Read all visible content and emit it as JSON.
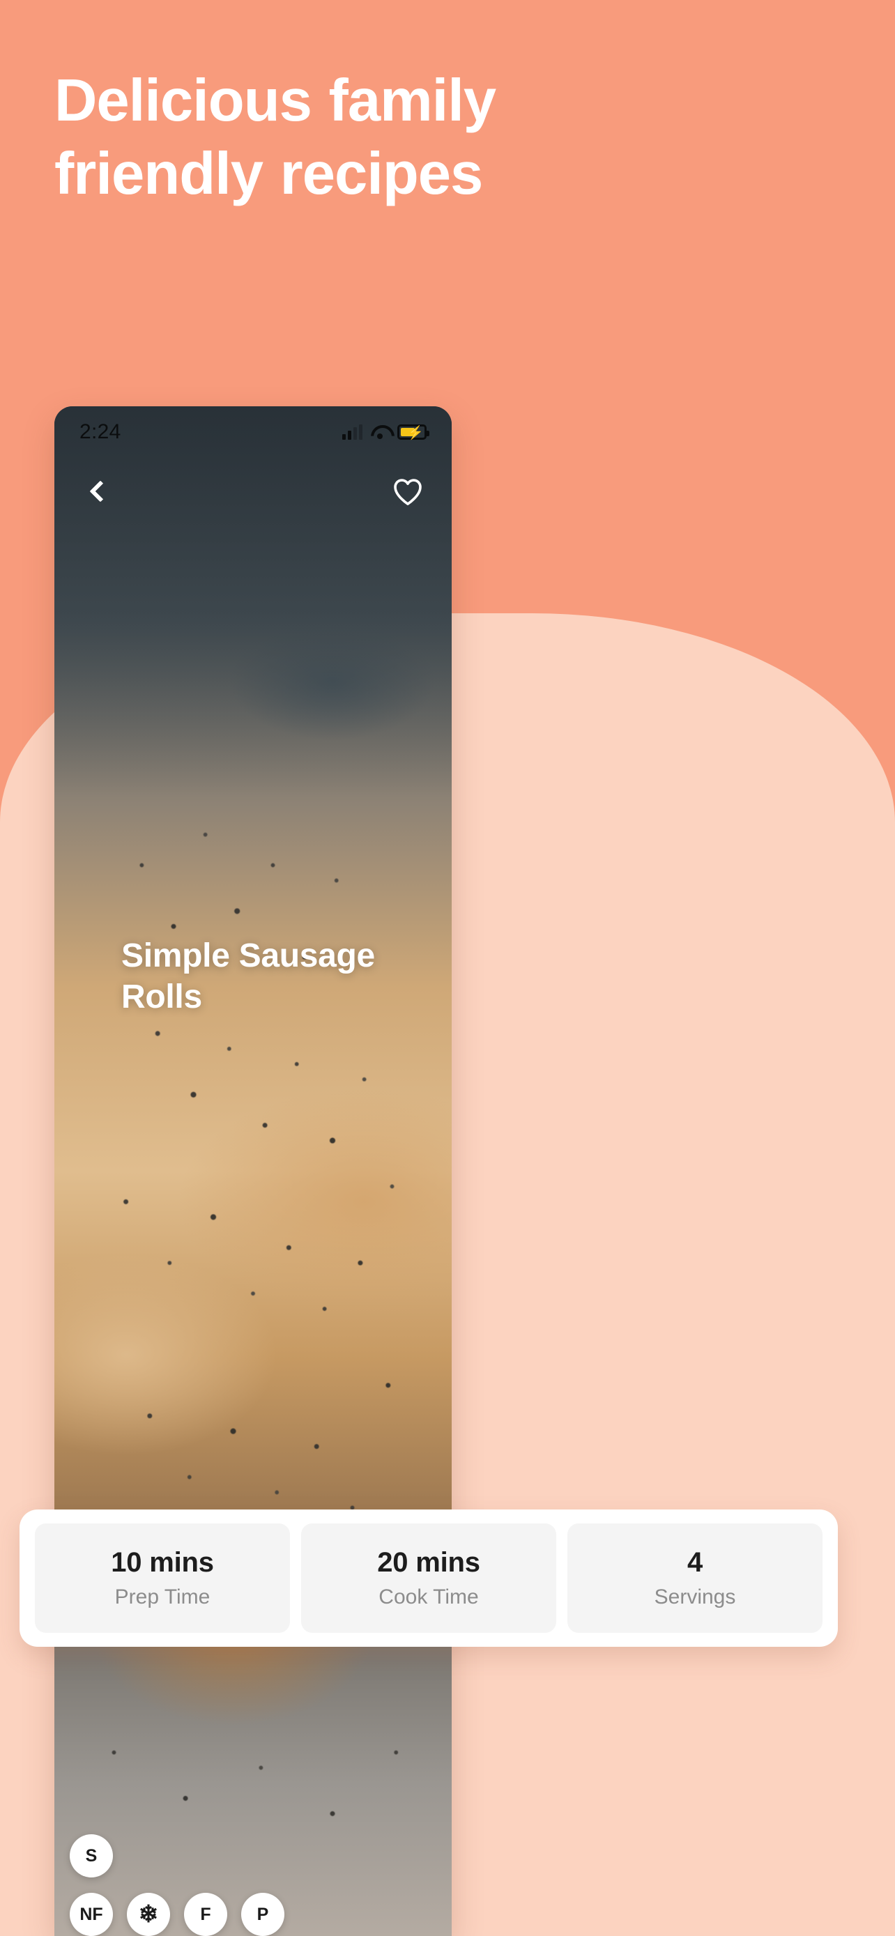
{
  "page": {
    "background_color": "#F89B7C",
    "wash_color": "#FCD3C0"
  },
  "hero": {
    "heading": "Delicious family friendly recipes",
    "text_color": "#FFFFFF"
  },
  "phone": {
    "status_bar": {
      "time": "2:24",
      "signal_icon": "cellular-signal-icon",
      "wifi_icon": "wifi-icon",
      "battery_icon": "battery-charging-icon",
      "battery_accent": "#F5C518"
    },
    "nav": {
      "back_icon": "back-chevron-icon",
      "favorite_icon": "heart-outline-icon"
    },
    "recipe": {
      "title": "Simple Sausage Rolls"
    },
    "badges": {
      "row1": [
        {
          "id": "badge-s",
          "label": "S"
        }
      ],
      "row2": [
        {
          "id": "badge-nf",
          "label": "NF"
        },
        {
          "id": "badge-freezer",
          "label": "❄"
        },
        {
          "id": "badge-f",
          "label": "F"
        },
        {
          "id": "badge-p",
          "label": "P"
        }
      ]
    }
  },
  "info_card": {
    "tiles": [
      {
        "value": "10 mins",
        "label": "Prep Time"
      },
      {
        "value": "20 mins",
        "label": "Cook Time"
      },
      {
        "value": "4",
        "label": "Servings"
      }
    ]
  }
}
